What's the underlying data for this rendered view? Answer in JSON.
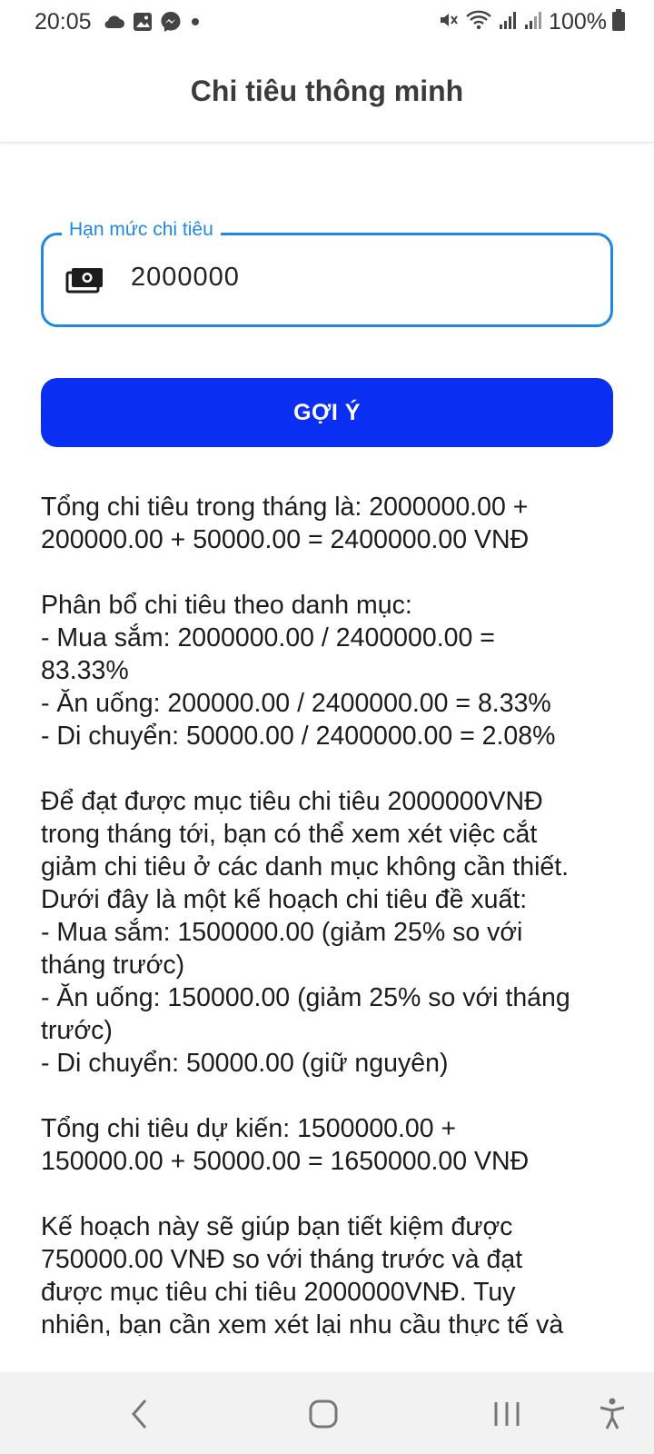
{
  "status_bar": {
    "time": "20:05",
    "battery": "100%",
    "left_icons": [
      "cloud-icon",
      "image-icon",
      "messenger-icon",
      "dot-icon"
    ],
    "right_icons": [
      "mute-icon",
      "wifi-icon",
      "signal-icon",
      "signal-icon-2",
      "battery-icon"
    ]
  },
  "app_bar": {
    "title": "Chi tiêu thông minh"
  },
  "budget_field": {
    "label": "Hạn mức chi tiêu",
    "value": "2000000",
    "icon": "money-icon",
    "accent_color": "#1e88e5"
  },
  "suggest_button": {
    "label": "GỢI Ý",
    "color": "#0a2ff2"
  },
  "result_text": "Tổng chi tiêu trong tháng là: 2000000.00 +\n200000.00 + 50000.00 = 2400000.00 VNĐ\n\nPhân bổ chi tiêu theo danh mục:\n- Mua sắm: 2000000.00 / 2400000.00 =\n83.33%\n- Ăn uống: 200000.00 / 2400000.00 = 8.33%\n- Di chuyển: 50000.00 / 2400000.00 = 2.08%\n\nĐể đạt được mục tiêu chi tiêu 2000000VNĐ\ntrong tháng tới, bạn có thể xem xét việc cắt\ngiảm chi tiêu ở các danh mục không cần thiết.\nDưới đây là một kế hoạch chi tiêu đề xuất:\n- Mua sắm: 1500000.00 (giảm 25% so với\ntháng trước)\n- Ăn uống: 150000.00 (giảm 25% so với tháng\ntrước)\n- Di chuyển: 50000.00 (giữ nguyên)\n\nTổng chi tiêu dự kiến: 1500000.00 +\n150000.00 + 50000.00 = 1650000.00 VNĐ\n\nKế hoạch này sẽ giúp bạn tiết kiệm được\n750000.00 VNĐ so với tháng trước và đạt\nđược mục tiêu chi tiêu 2000000VNĐ. Tuy\nnhiên, bạn cần xem xét lại nhu cầu thực tế và",
  "nav_bar": {
    "buttons": [
      "back-icon",
      "home-icon",
      "recents-icon",
      "accessibility-icon"
    ]
  }
}
